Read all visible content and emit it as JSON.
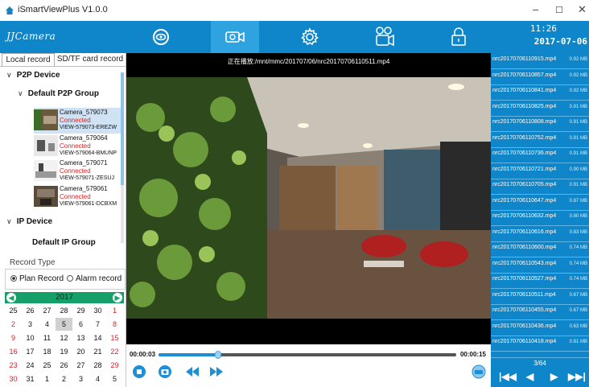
{
  "window": {
    "title": "iSmartViewPlus  V1.0.0",
    "minimize": "–",
    "maximize": "☐",
    "close": "✕"
  },
  "toolbar": {
    "logo": "JJCamera",
    "buttons": [
      {
        "name": "live-view",
        "icon": "eye-icon"
      },
      {
        "name": "playback",
        "icon": "video-camera-icon"
      },
      {
        "name": "settings",
        "icon": "gear-icon"
      },
      {
        "name": "record",
        "icon": "record-camera-icon"
      },
      {
        "name": "lock",
        "icon": "lock-icon"
      }
    ],
    "active_index": 1,
    "clock_time": "11:26",
    "clock_date": "2017-07-06",
    "accent": "#0e86c9"
  },
  "left": {
    "tabs": [
      "Local record",
      "SD/TF card record"
    ],
    "active_tab": 0,
    "p2p_device": "P2P Device",
    "default_p2p_group": "Default P2P Group",
    "cameras": [
      {
        "name": "Camera_579073",
        "status": "Connected",
        "uid": "VIEW-579073-EREZW"
      },
      {
        "name": "Camera_579064",
        "status": "Connected",
        "uid": "VIEW-579064-BMUNP"
      },
      {
        "name": "Camera_579071",
        "status": "Connected",
        "uid": "VIEW-579071-ZESUJ"
      },
      {
        "name": "Camera_579061",
        "status": "Connected",
        "uid": "VIEW-579061-DCBXM"
      }
    ],
    "ip_device": "IP Device",
    "default_ip_group": "Default IP Group",
    "record_type_label": "Record Type",
    "plan_record": "Plan Record",
    "alarm_record": "Alarm record",
    "calendar": {
      "year": "2017",
      "days": [
        [
          "25",
          "26",
          "27",
          "28",
          "29",
          "30",
          "1"
        ],
        [
          "2",
          "3",
          "4",
          "5",
          "6",
          "7",
          "8"
        ],
        [
          "9",
          "10",
          "11",
          "12",
          "13",
          "14",
          "15"
        ],
        [
          "16",
          "17",
          "18",
          "19",
          "20",
          "21",
          "22"
        ],
        [
          "23",
          "24",
          "25",
          "26",
          "27",
          "28",
          "29"
        ],
        [
          "30",
          "31",
          "1",
          "2",
          "3",
          "4",
          "5"
        ]
      ],
      "selected": "5"
    }
  },
  "video": {
    "playing": "正在播放:/mnt/mmc/201707/06/nrc20170706110511.mp4",
    "time_current": "00:00:03",
    "time_total": "00:00:15",
    "progress": 0.2
  },
  "files": [
    {
      "name": "nrc20170706110915.mp4",
      "size": "0.92 MB"
    },
    {
      "name": "nrc20170706110857.mp4",
      "size": "0.92 MB"
    },
    {
      "name": "nrc20170706110841.mp4",
      "size": "0.92 MB"
    },
    {
      "name": "nrc20170706110825.mp4",
      "size": "0.91 MB"
    },
    {
      "name": "nrc20170706110808.mp4",
      "size": "0.91 MB"
    },
    {
      "name": "nrc20170706110752.mp4",
      "size": "0.91 MB"
    },
    {
      "name": "nrc20170706110736.mp4",
      "size": "0.91 MB"
    },
    {
      "name": "nrc20170706110721.mp4",
      "size": "0.90 MB"
    },
    {
      "name": "nrc20170706110705.mp4",
      "size": "0.91 MB"
    },
    {
      "name": "nrc20170706110647.mp4",
      "size": "0.87 MB"
    },
    {
      "name": "nrc20170706110632.mp4",
      "size": "0.80 MB"
    },
    {
      "name": "nrc20170706110616.mp4",
      "size": "0.83 MB"
    },
    {
      "name": "nrc20170706110600.mp4",
      "size": "0.74 MB"
    },
    {
      "name": "nrc20170706110543.mp4",
      "size": "0.74 MB"
    },
    {
      "name": "nrc20170706110527.mp4",
      "size": "0.74 MB"
    },
    {
      "name": "nrc20170706110511.mp4",
      "size": "0.67 MB"
    },
    {
      "name": "nrc20170706110455.mp4",
      "size": "0.67 MB"
    },
    {
      "name": "nrc20170706110436.mp4",
      "size": "0.63 MB"
    },
    {
      "name": "nrc20170706110418.mp4",
      "size": "0.81 MB"
    }
  ],
  "pager": {
    "text": "3/64",
    "first": "|◀◀",
    "prev": "◀",
    "next": "▶",
    "last": "▶▶|"
  }
}
